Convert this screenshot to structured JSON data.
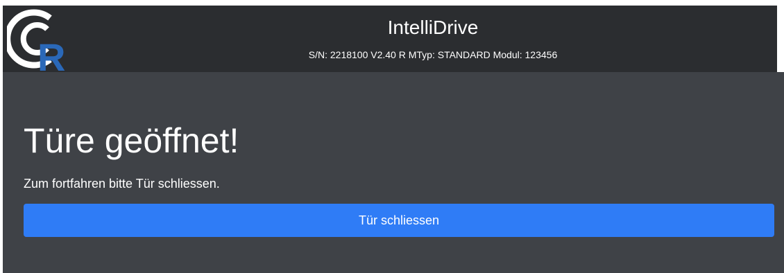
{
  "header": {
    "title": "IntelliDrive",
    "subtitle": "S/N: 2218100 V2.40 R MTyp: STANDARD Modul: 123456",
    "logo_icon": "r-signal-logo-icon",
    "logo_letter": "R"
  },
  "main": {
    "headline": "Türe geöffnet!",
    "message": "Zum fortfahren bitte Tür schliessen.",
    "button_label": "Tür schliessen"
  },
  "colors": {
    "header_bg": "#2b2d30",
    "content_bg": "#3f4247",
    "button_bg": "#2f7cf6",
    "logo_blue": "#2a68b8",
    "text": "#ffffff"
  }
}
